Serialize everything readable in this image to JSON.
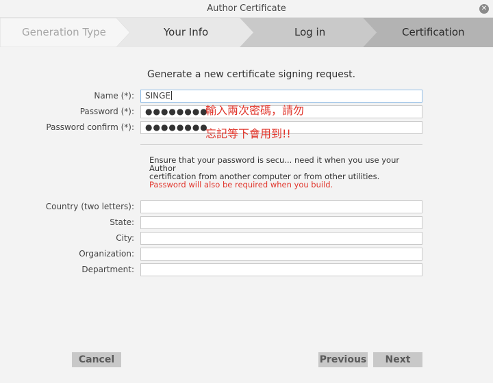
{
  "window": {
    "title": "Author Certificate",
    "close_glyph": "✕"
  },
  "steps": [
    {
      "label": "Generation Type"
    },
    {
      "label": "Your Info"
    },
    {
      "label": "Log in"
    },
    {
      "label": "Certification"
    }
  ],
  "form": {
    "heading": "Generate a new certificate signing request.",
    "name_label": "Name (*):",
    "name_value": "SINGE",
    "password_label": "Password (*):",
    "password_value": "●●●●●●●●",
    "password_confirm_label": "Password confirm (*):",
    "password_confirm_value": "●●●●●●●●",
    "country_label": "Country (two letters):",
    "state_label": "State:",
    "city_label": "City:",
    "organization_label": "Organization:",
    "department_label": "Department:"
  },
  "annotation": {
    "line1": "輸入兩次密碼，請勿",
    "line2": "忘記等下會用到!!"
  },
  "note": {
    "line1": "Ensure that your password is secu... need it when you use your Author",
    "line2": "certification from another computer or from other utilities.",
    "warning": "Password will also be required when you build."
  },
  "buttons": {
    "cancel": "Cancel",
    "previous": "Previous",
    "next": "Next"
  }
}
